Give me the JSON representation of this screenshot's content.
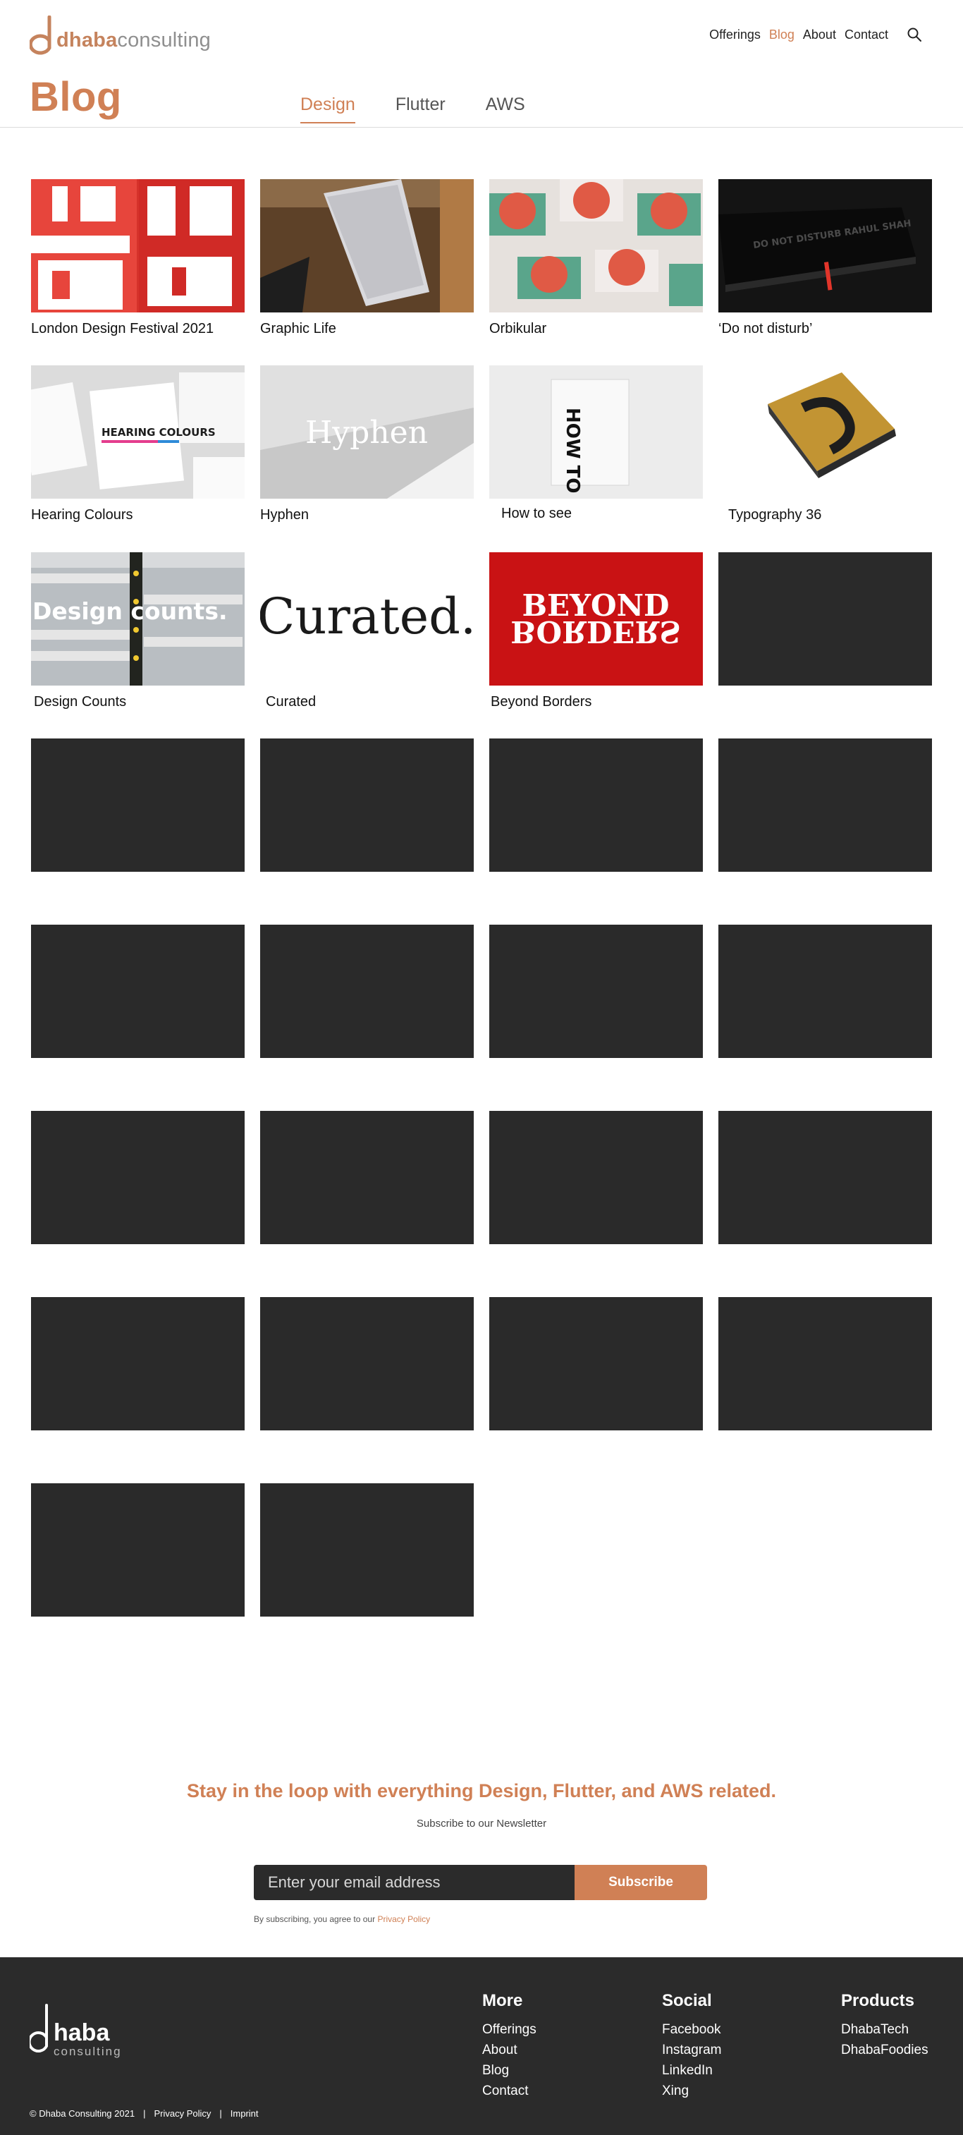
{
  "brand": {
    "name_bold": "dhaba",
    "name_light": "consulting",
    "accent": "#d08055"
  },
  "nav": {
    "items": [
      {
        "label": "Offerings",
        "active": false
      },
      {
        "label": "Blog",
        "active": true
      },
      {
        "label": "About",
        "active": false
      },
      {
        "label": "Contact",
        "active": false
      }
    ],
    "search_icon": "search-icon"
  },
  "page": {
    "title": "Blog",
    "tabs": [
      {
        "label": "Design",
        "active": true
      },
      {
        "label": "Flutter",
        "active": false
      },
      {
        "label": "AWS",
        "active": false
      }
    ]
  },
  "posts": [
    {
      "title": "London Design Festival 2021",
      "thumb_text": ""
    },
    {
      "title": "Graphic Life",
      "thumb_text": ""
    },
    {
      "title": "Orbikular",
      "thumb_text": ""
    },
    {
      "title": "‘Do not disturb’",
      "thumb_text": "DO NOT DISTURB RAHUL SHAH"
    },
    {
      "title": "Hearing Colours",
      "thumb_text": "HEARING COLOURS"
    },
    {
      "title": "Hyphen",
      "thumb_text": "Hyphen"
    },
    {
      "title": "How to see",
      "thumb_text": "HOW TO SEE"
    },
    {
      "title": "Typography 36",
      "thumb_text": ""
    },
    {
      "title": "Design Counts",
      "thumb_text": "Design counts."
    },
    {
      "title": "Curated",
      "thumb_text": "Curated."
    },
    {
      "title": "Beyond Borders",
      "thumb_text": "BEYOND"
    },
    {
      "title": "",
      "thumb_text": ""
    },
    {
      "title": "",
      "thumb_text": ""
    },
    {
      "title": "",
      "thumb_text": ""
    },
    {
      "title": "",
      "thumb_text": ""
    },
    {
      "title": "",
      "thumb_text": ""
    },
    {
      "title": "",
      "thumb_text": ""
    },
    {
      "title": "",
      "thumb_text": ""
    },
    {
      "title": "",
      "thumb_text": ""
    },
    {
      "title": "",
      "thumb_text": ""
    },
    {
      "title": "",
      "thumb_text": ""
    },
    {
      "title": "",
      "thumb_text": ""
    },
    {
      "title": "",
      "thumb_text": ""
    },
    {
      "title": "",
      "thumb_text": ""
    },
    {
      "title": "",
      "thumb_text": ""
    },
    {
      "title": "",
      "thumb_text": ""
    },
    {
      "title": "",
      "thumb_text": ""
    },
    {
      "title": "",
      "thumb_text": ""
    },
    {
      "title": "",
      "thumb_text": ""
    },
    {
      "title": "",
      "thumb_text": ""
    }
  ],
  "newsletter": {
    "title": "Stay in the loop with everything Design, Flutter, and AWS related.",
    "subtitle": "Subscribe to our Newsletter",
    "placeholder": "Enter your email address",
    "button": "Subscribe",
    "note": "By subscribing, you agree to our",
    "note_link": "Privacy Policy"
  },
  "footer": {
    "logo_big": "haba",
    "logo_small": "consulting",
    "columns": [
      {
        "heading": "More",
        "links": [
          "Offerings",
          "About",
          "Blog",
          "Contact"
        ]
      },
      {
        "heading": "Social",
        "links": [
          "Facebook",
          "Instagram",
          "LinkedIn",
          "Xing"
        ]
      },
      {
        "heading": "Products",
        "links": [
          "DhabaTech",
          "DhabaFoodies"
        ]
      }
    ],
    "copyright": "© Dhaba Consulting 2021",
    "sep": "|",
    "privacy": "Privacy Policy",
    "imprint": "Imprint"
  }
}
